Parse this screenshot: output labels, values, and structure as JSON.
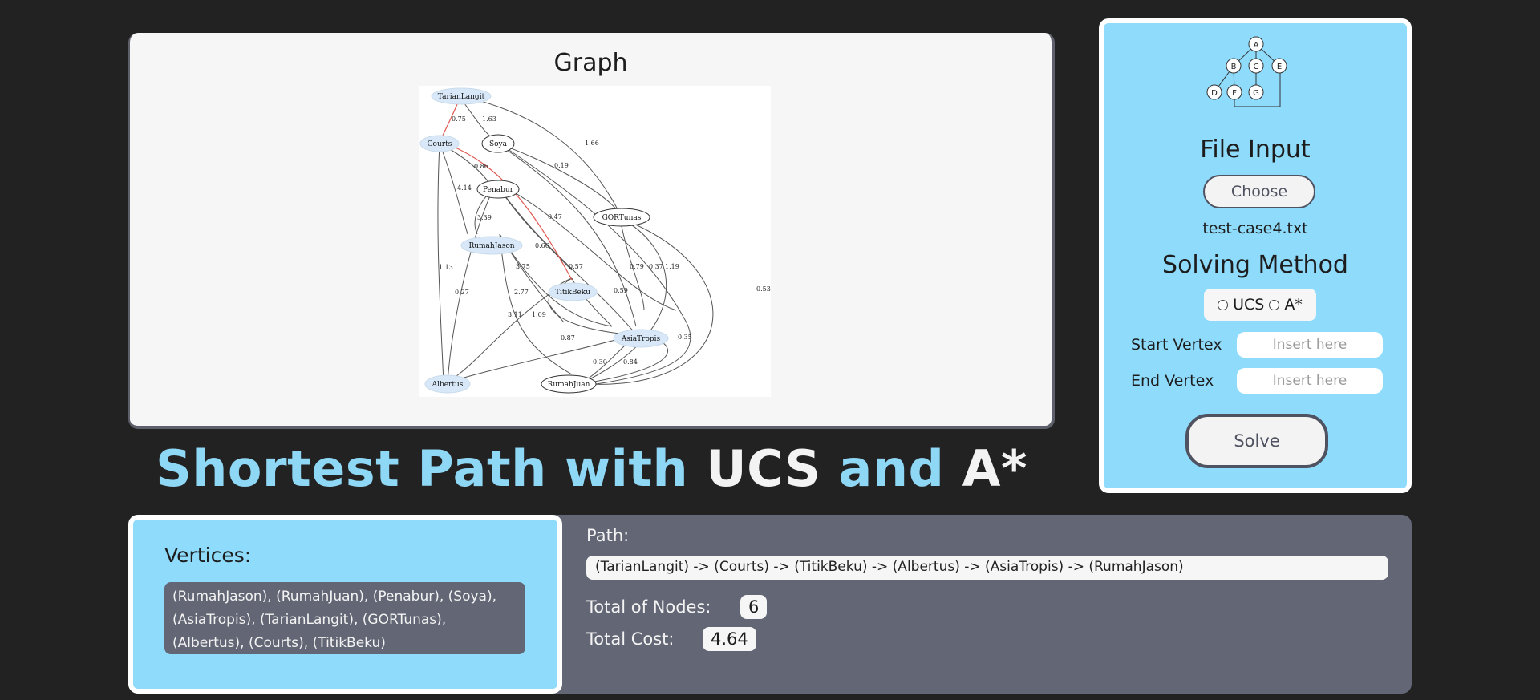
{
  "graph": {
    "title": "Graph",
    "nodes": [
      "TarianLangit",
      "Courts",
      "Soya",
      "Penabur",
      "GORTunas",
      "RumahJason",
      "TitikBeku",
      "AsiaTropis",
      "Albertus",
      "RumahJuan"
    ],
    "edge_labels": [
      "0.75",
      "1.63",
      "1.66",
      "0.86",
      "0.19",
      "4.14",
      "3.39",
      "0.47",
      "0.66",
      "1.13",
      "0.27",
      "3.75",
      "2.77",
      "0.57",
      "0.79",
      "0.37",
      "1.19",
      "0.53",
      "3.11",
      "1.09",
      "0.59",
      "0.87",
      "0.35",
      "0.30",
      "0.84"
    ],
    "highlight_color": "#e0554f",
    "highlight_fill": "#d8e8f8"
  },
  "heading": {
    "part1": "Shortest Path with",
    "part2": "UCS",
    "part3": "and",
    "part4": "A*"
  },
  "control": {
    "tree_nodes": [
      "A",
      "B",
      "C",
      "E",
      "D",
      "F",
      "G"
    ],
    "file_input_title": "File Input",
    "choose_label": "Choose",
    "file_name": "test-case4.txt",
    "solving_title": "Solving Method",
    "method_ucs": "UCS",
    "method_astar": "A*",
    "start_label": "Start Vertex",
    "start_placeholder": "Insert here",
    "end_label": "End Vertex",
    "end_placeholder": "Insert here",
    "solve_label": "Solve"
  },
  "result": {
    "vertices_title": "Vertices:",
    "vertices_text": "(RumahJason), (RumahJuan), (Penabur), (Soya), (AsiaTropis), (TarianLangit), (GORTunas), (Albertus), (Courts), (TitikBeku)",
    "path_label": "Path:",
    "path_text": "(TarianLangit) -> (Courts) -> (TitikBeku) -> (Albertus) -> (AsiaTropis) -> (RumahJason)",
    "nodes_label": "Total of Nodes:",
    "nodes_value": "6",
    "cost_label": "Total Cost:",
    "cost_value": "4.64"
  },
  "colors": {
    "background": "#222222",
    "panel_blue": "#8edbfb",
    "heading_blue": "#8ed7f5",
    "result_gray": "#636674"
  }
}
